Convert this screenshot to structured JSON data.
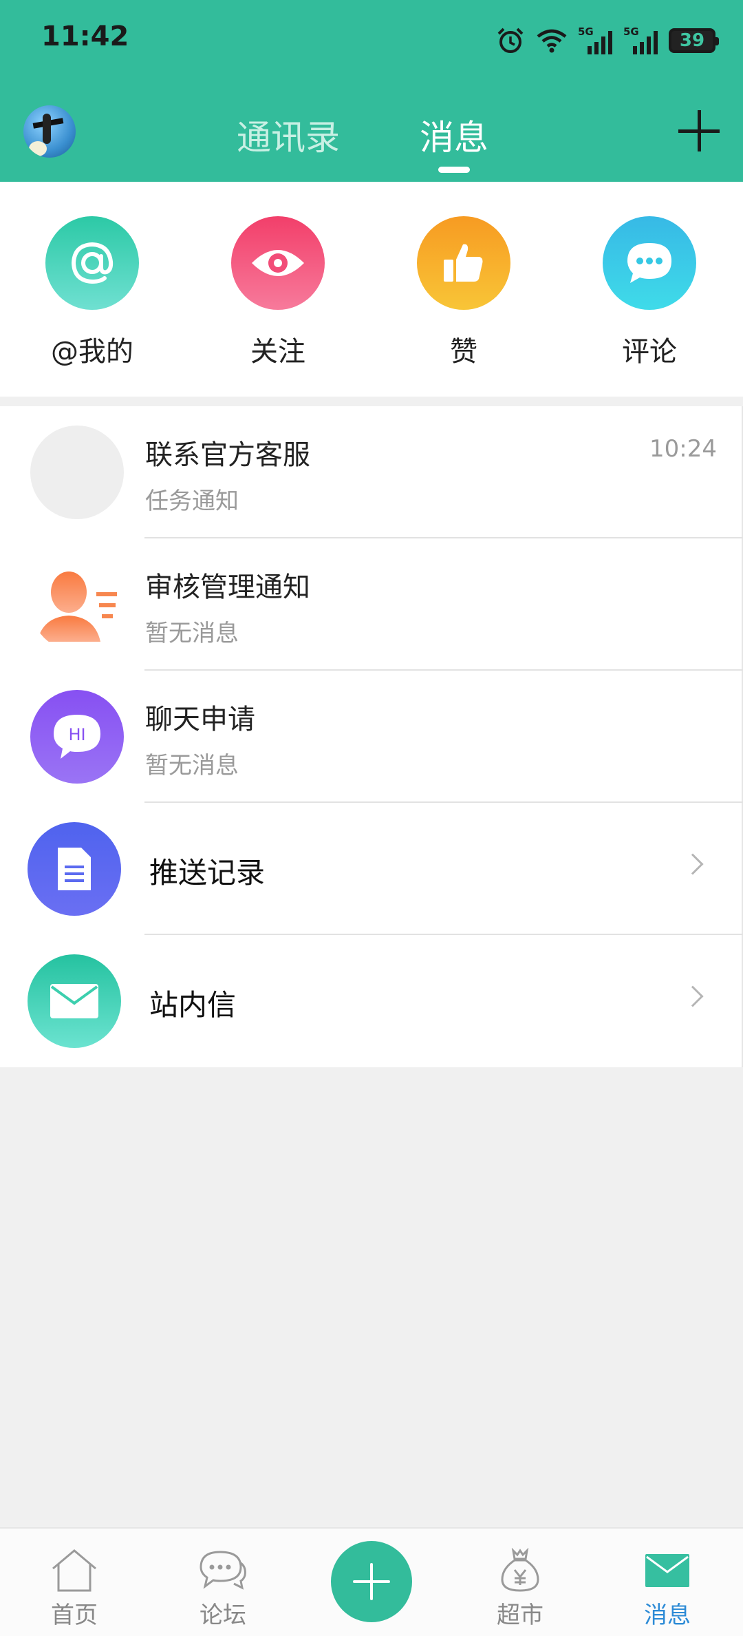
{
  "status_bar": {
    "time": "11:42",
    "battery": "39",
    "network_1": "5G",
    "network_2": "5G",
    "icons": [
      "alarm-icon",
      "wifi-icon",
      "signal-5g-icon",
      "signal-5g-icon",
      "battery-icon"
    ]
  },
  "header": {
    "tabs": [
      {
        "label": "通讯录",
        "active": false
      },
      {
        "label": "消息",
        "active": true
      }
    ],
    "add_icon": "plus-icon",
    "accent": "#33bc9b"
  },
  "quick_actions": [
    {
      "label": "@我的",
      "icon": "at-icon",
      "color": "#3ccfae"
    },
    {
      "label": "关注",
      "icon": "eye-icon",
      "color": "#f24d78"
    },
    {
      "label": "赞",
      "icon": "thumbs-up-icon",
      "color": "#f8ab26"
    },
    {
      "label": "评论",
      "icon": "comment-icon",
      "color": "#35c8e4"
    }
  ],
  "messages": [
    {
      "title": "联系官方客服",
      "subtitle": "任务通知",
      "time": "10:24"
    },
    {
      "title": "审核管理通知",
      "subtitle": "暂无消息"
    },
    {
      "title": "聊天申请",
      "subtitle": "暂无消息",
      "icon_text": "HI"
    }
  ],
  "links": [
    {
      "label": "推送记录",
      "icon": "document-icon"
    },
    {
      "label": "站内信",
      "icon": "envelope-icon"
    }
  ],
  "bottom_nav": [
    {
      "label": "首页",
      "icon": "home-icon",
      "active": false
    },
    {
      "label": "论坛",
      "icon": "chat-bubble-icon",
      "active": false
    },
    {
      "label": "超市",
      "icon": "money-bag-icon",
      "active": false
    },
    {
      "label": "消息",
      "icon": "mail-icon",
      "active": true
    }
  ]
}
